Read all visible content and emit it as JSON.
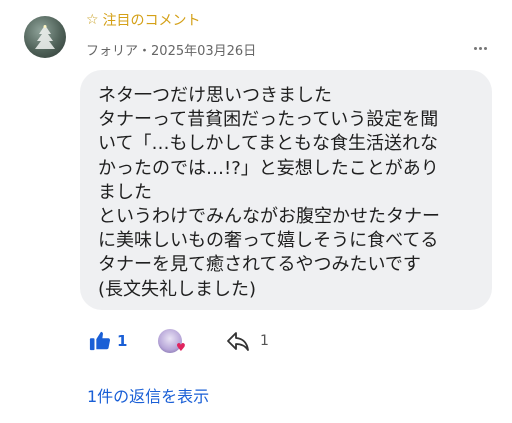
{
  "header": {
    "featured_label": "注目のコメント",
    "featured_icon": "star-outline",
    "author": "フォリア",
    "separator": "・",
    "date": "2025年03月26日"
  },
  "comment": {
    "lines": [
      "ネタ一つだけ思いつきました",
      "タナーって昔貧困だったっていう設定を聞",
      "いて「…もしかしてまともな食生活送れな",
      "かったのでは…!?」と妄想したことがあり",
      "ました",
      "というわけでみんながお腹空かせたタナー",
      "に美味しいもの奢って嬉しそうに食べてる",
      "タナーを見て癒されてるやつみたいです",
      "(長文失礼しました)"
    ]
  },
  "actions": {
    "like_count": "1",
    "share_count": "1",
    "like_color": "#1a5fd6",
    "heart_color": "#e0245e"
  },
  "replies": {
    "label": "1件の返信を表示"
  }
}
